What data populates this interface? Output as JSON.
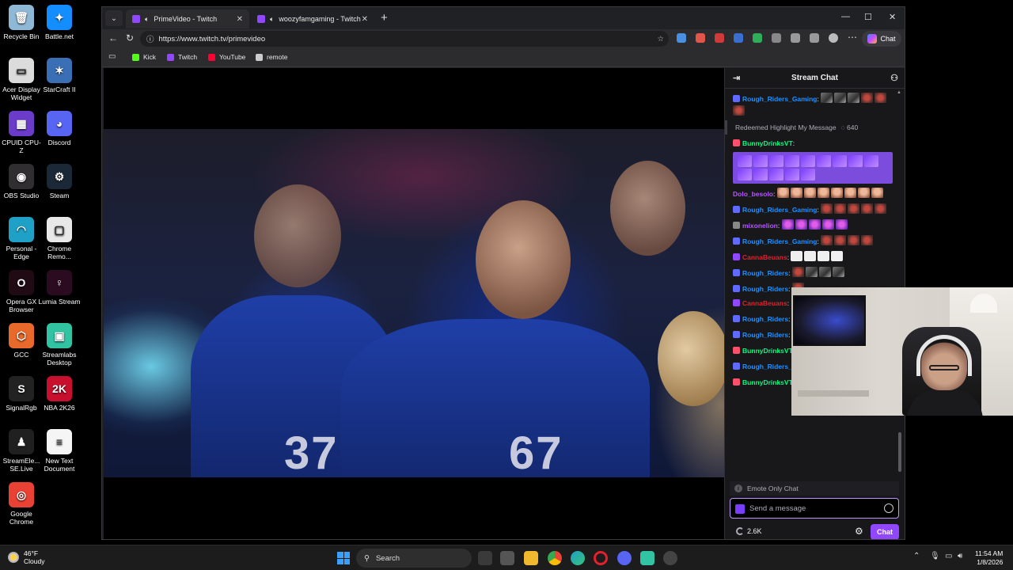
{
  "desktop": {
    "icons": [
      {
        "label": "Recycle Bin",
        "icon": "recycle-bin-icon",
        "color": "#8fb8d6",
        "glyph": "🗑"
      },
      {
        "label": "Battle.net",
        "icon": "battlenet-icon",
        "color": "#148eff",
        "glyph": "✦"
      },
      {
        "label": "Acer Display Widget",
        "icon": "acer-display-icon",
        "color": "#dcdcdc",
        "glyph": "▭"
      },
      {
        "label": "StarCraft II",
        "icon": "starcraft-icon",
        "color": "#3b6fb5",
        "glyph": "✶"
      },
      {
        "label": "CPUID CPU-Z",
        "icon": "cpuz-icon",
        "color": "#6b3cc9",
        "glyph": "▦"
      },
      {
        "label": "Discord",
        "icon": "discord-icon",
        "color": "#5865f2",
        "glyph": "◕"
      },
      {
        "label": "OBS Studio",
        "icon": "obs-icon",
        "color": "#302e31",
        "glyph": "◉"
      },
      {
        "label": "Steam",
        "icon": "steam-icon",
        "color": "#1b2838",
        "glyph": "⚙"
      },
      {
        "label": "Personal - Edge",
        "icon": "edge-icon",
        "color": "#1fa0c6",
        "glyph": "◠"
      },
      {
        "label": "Chrome Remo...",
        "icon": "chrome-remote-icon",
        "color": "#e8e8e8",
        "glyph": "▢"
      },
      {
        "label": "Opera GX Browser",
        "icon": "operagx-icon",
        "color": "#200a14",
        "glyph": "O"
      },
      {
        "label": "Lumia Stream",
        "icon": "lumia-icon",
        "color": "#2b0b1f",
        "glyph": "♀"
      },
      {
        "label": "GCC",
        "icon": "gcc-icon",
        "color": "#e8692a",
        "glyph": "⬡"
      },
      {
        "label": "Streamlabs Desktop",
        "icon": "streamlabs-icon",
        "color": "#31c3a2",
        "glyph": "▣"
      },
      {
        "label": "SignalRgb",
        "icon": "signalrgb-icon",
        "color": "#222",
        "glyph": "S"
      },
      {
        "label": "NBA 2K26",
        "icon": "nba2k-icon",
        "color": "#c8102e",
        "glyph": "2K"
      },
      {
        "label": "StreamEle... SE.Live",
        "icon": "streamelements-icon",
        "color": "#202020",
        "glyph": "♟"
      },
      {
        "label": "New Text Document",
        "icon": "text-document-icon",
        "color": "#f5f5f5",
        "glyph": "≡"
      },
      {
        "label": "Google Chrome",
        "icon": "chrome-icon",
        "color": "#e94235",
        "glyph": "◎"
      }
    ]
  },
  "browser": {
    "tabs": [
      {
        "label": "PrimeVideo - Twitch"
      },
      {
        "label": "woozyfamgaming - Twitch"
      }
    ],
    "url": "https://www.twitch.tv/primevideo",
    "chat_button": "Chat",
    "bookmarks": [
      {
        "label": "Kick",
        "color": "#53fc18"
      },
      {
        "label": "Twitch",
        "color": "#9146ff"
      },
      {
        "label": "YouTube",
        "color": "#ff0033"
      },
      {
        "label": "remote",
        "color": "#cccccc"
      }
    ]
  },
  "video": {
    "jersey_numbers": [
      "37",
      "67"
    ]
  },
  "chat": {
    "title": "Stream Chat",
    "messages": [
      {
        "user": "Rough_Riders_Gaming",
        "color": "#1e90ff",
        "badge": "#5f6bff",
        "emotes": [
          "grey",
          "grey",
          "grey",
          "bug",
          "bug",
          "bug"
        ]
      },
      {
        "type": "highlight",
        "text": "Redeemed Highlight My Message",
        "points": "640"
      },
      {
        "user": "BunnyDrinksVT",
        "color": "#00ff7f",
        "badge": "#ff4f6a",
        "emotes": [
          "purple",
          "purple",
          "purple",
          "purple",
          "purple",
          "purple",
          "purple",
          "purple",
          "purple",
          "purple",
          "purple",
          "purple",
          "purple",
          "purple"
        ],
        "highlighted": true
      },
      {
        "user": "Dolo_besolo",
        "color": "#b357ff",
        "badge": "",
        "emotes": [
          "hand",
          "hand",
          "hand",
          "hand",
          "hand",
          "hand",
          "hand",
          "hand"
        ]
      },
      {
        "user": "Rough_Riders_Gaming",
        "color": "#1e90ff",
        "badge": "#5f6bff",
        "emotes": [
          "bug",
          "bug",
          "bug",
          "bug",
          "bug"
        ]
      },
      {
        "user": "mixonelion",
        "color": "#b357ff",
        "badge": "#888888",
        "emotes": [
          "pink",
          "pink",
          "pink",
          "pink",
          "pink"
        ]
      },
      {
        "user": "Rough_Riders_Gaming",
        "color": "#1e90ff",
        "badge": "#5f6bff",
        "emotes": [
          "bug",
          "bug",
          "bug",
          "bug"
        ]
      },
      {
        "user": "CannaBeuans",
        "color": "#e1212b",
        "badge": "#9146ff",
        "emotes": [
          "white",
          "white",
          "white",
          "white"
        ]
      },
      {
        "user": "Rough_Riders",
        "color": "#1e90ff",
        "badge": "#5f6bff",
        "emotes": [
          "bug",
          "grey",
          "grey",
          "grey"
        ]
      },
      {
        "user": "Rough_Riders",
        "color": "#1e90ff",
        "badge": "#5f6bff",
        "emotes": [
          "bug"
        ]
      },
      {
        "user": "CannaBeuans",
        "color": "#e1212b",
        "badge": "#9146ff",
        "emotes": []
      },
      {
        "user": "Rough_Riders",
        "color": "#1e90ff",
        "badge": "#5f6bff",
        "emotes": [
          "grey",
          "grey"
        ]
      },
      {
        "user": "Rough_Riders",
        "color": "#1e90ff",
        "badge": "#5f6bff",
        "emotes": [
          "bug",
          "grey",
          "grey",
          "grey"
        ]
      },
      {
        "user": "BunnyDrinksVT",
        "color": "#00ff7f",
        "badge": "#ff4f6a",
        "emotes": [
          "white",
          "white",
          "white"
        ]
      },
      {
        "user": "Rough_Riders_Gaming",
        "color": "#1e90ff",
        "badge": "#5f6bff",
        "emotes": [
          "bug",
          "bug",
          "bug",
          "bug",
          "bug"
        ]
      },
      {
        "user": "BunnyDrinksVT",
        "color": "#00ff7f",
        "badge": "#ff4f6a",
        "emotes": [
          "girl",
          "girl",
          "girl"
        ]
      }
    ],
    "emote_only": "Emote Only Chat",
    "input_placeholder": "Send a message",
    "points": "2.6K",
    "send_button": "Chat"
  },
  "taskbar": {
    "temperature": "46°F",
    "weather": "Cloudy",
    "search_placeholder": "Search",
    "time": "11:54 AM",
    "date": "1/8/2026"
  }
}
